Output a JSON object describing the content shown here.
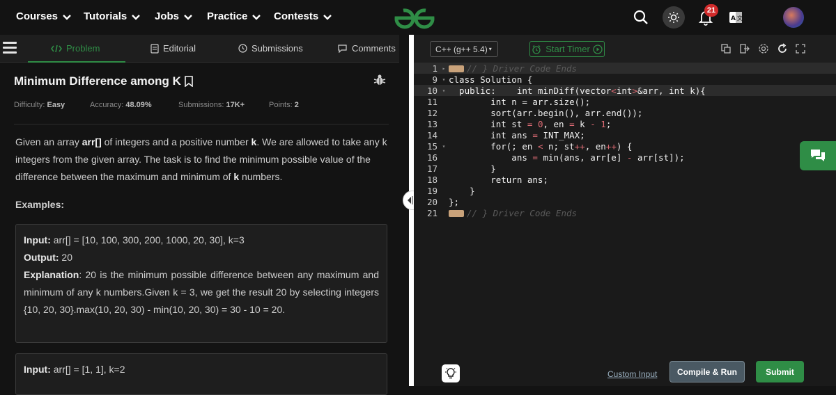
{
  "nav": {
    "items": [
      "Courses",
      "Tutorials",
      "Jobs",
      "Practice",
      "Contests"
    ],
    "notification_count": "21"
  },
  "tabs": {
    "problem": "Problem",
    "editorial": "Editorial",
    "submissions": "Submissions",
    "comments": "Comments"
  },
  "problem": {
    "title": "Minimum Difference among K",
    "difficulty_label": "Difficulty:",
    "difficulty": "Easy",
    "accuracy_label": "Accuracy:",
    "accuracy": "48.09%",
    "submissions_label": "Submissions:",
    "submissions": "17K+",
    "points_label": "Points:",
    "points": "2",
    "examples_label": "Examples:"
  },
  "example1": {
    "input_label": "Input:",
    "input": "arr[] = [10, 100, 300, 200, 1000, 20, 30], k=3",
    "output_label": "Output:",
    "output": "20",
    "explanation_label": "Explanation",
    "explanation": ": 20 is the minimum possible difference between any maximum and minimum of any k numbers.Given k = 3, we get the result 20 by selecting integers {10, 20, 30}.max(10, 20, 30) - min(10, 20, 30) = 30 - 10 = 20."
  },
  "example2": {
    "input_label": "Input:",
    "input": "arr[] = [1, 1], k=2"
  },
  "editor": {
    "language": "C++ (g++ 5.4)",
    "timer_label": "Start Timer",
    "custom_input": "Custom Input",
    "compile_label": "Compile & Run",
    "submit_label": "Submit"
  },
  "code_lines": [
    {
      "n": "1",
      "fold": "▸",
      "text": "// } Driver Code Ends",
      "type": "comment"
    },
    {
      "n": "9",
      "fold": "▾",
      "text": "class Solution {",
      "type": "code"
    },
    {
      "n": "10",
      "fold": "▾",
      "text": "  public:    int minDiff(vector<int>&arr, int k){",
      "type": "code"
    },
    {
      "n": "11",
      "fold": "",
      "text": "        int n = arr.size();",
      "type": "code"
    },
    {
      "n": "12",
      "fold": "",
      "text": "        sort(arr.begin(), arr.end());",
      "type": "code"
    },
    {
      "n": "13",
      "fold": "",
      "text": "        int st = 0, en = k - 1;",
      "type": "code"
    },
    {
      "n": "14",
      "fold": "",
      "text": "        int ans = INT_MAX;",
      "type": "code"
    },
    {
      "n": "15",
      "fold": "▾",
      "text": "        for(; en < n; st++, en++) {",
      "type": "code"
    },
    {
      "n": "16",
      "fold": "",
      "text": "            ans = min(ans, arr[e] - arr[st]);",
      "type": "code"
    },
    {
      "n": "17",
      "fold": "",
      "text": "        }",
      "type": "code"
    },
    {
      "n": "18",
      "fold": "",
      "text": "        return ans;",
      "type": "code"
    },
    {
      "n": "19",
      "fold": "",
      "text": "    }",
      "type": "code"
    },
    {
      "n": "20",
      "fold": "",
      "text": "};",
      "type": "code"
    },
    {
      "n": "21",
      "fold": "",
      "text": "// } Driver Code Ends",
      "type": "comment"
    }
  ]
}
